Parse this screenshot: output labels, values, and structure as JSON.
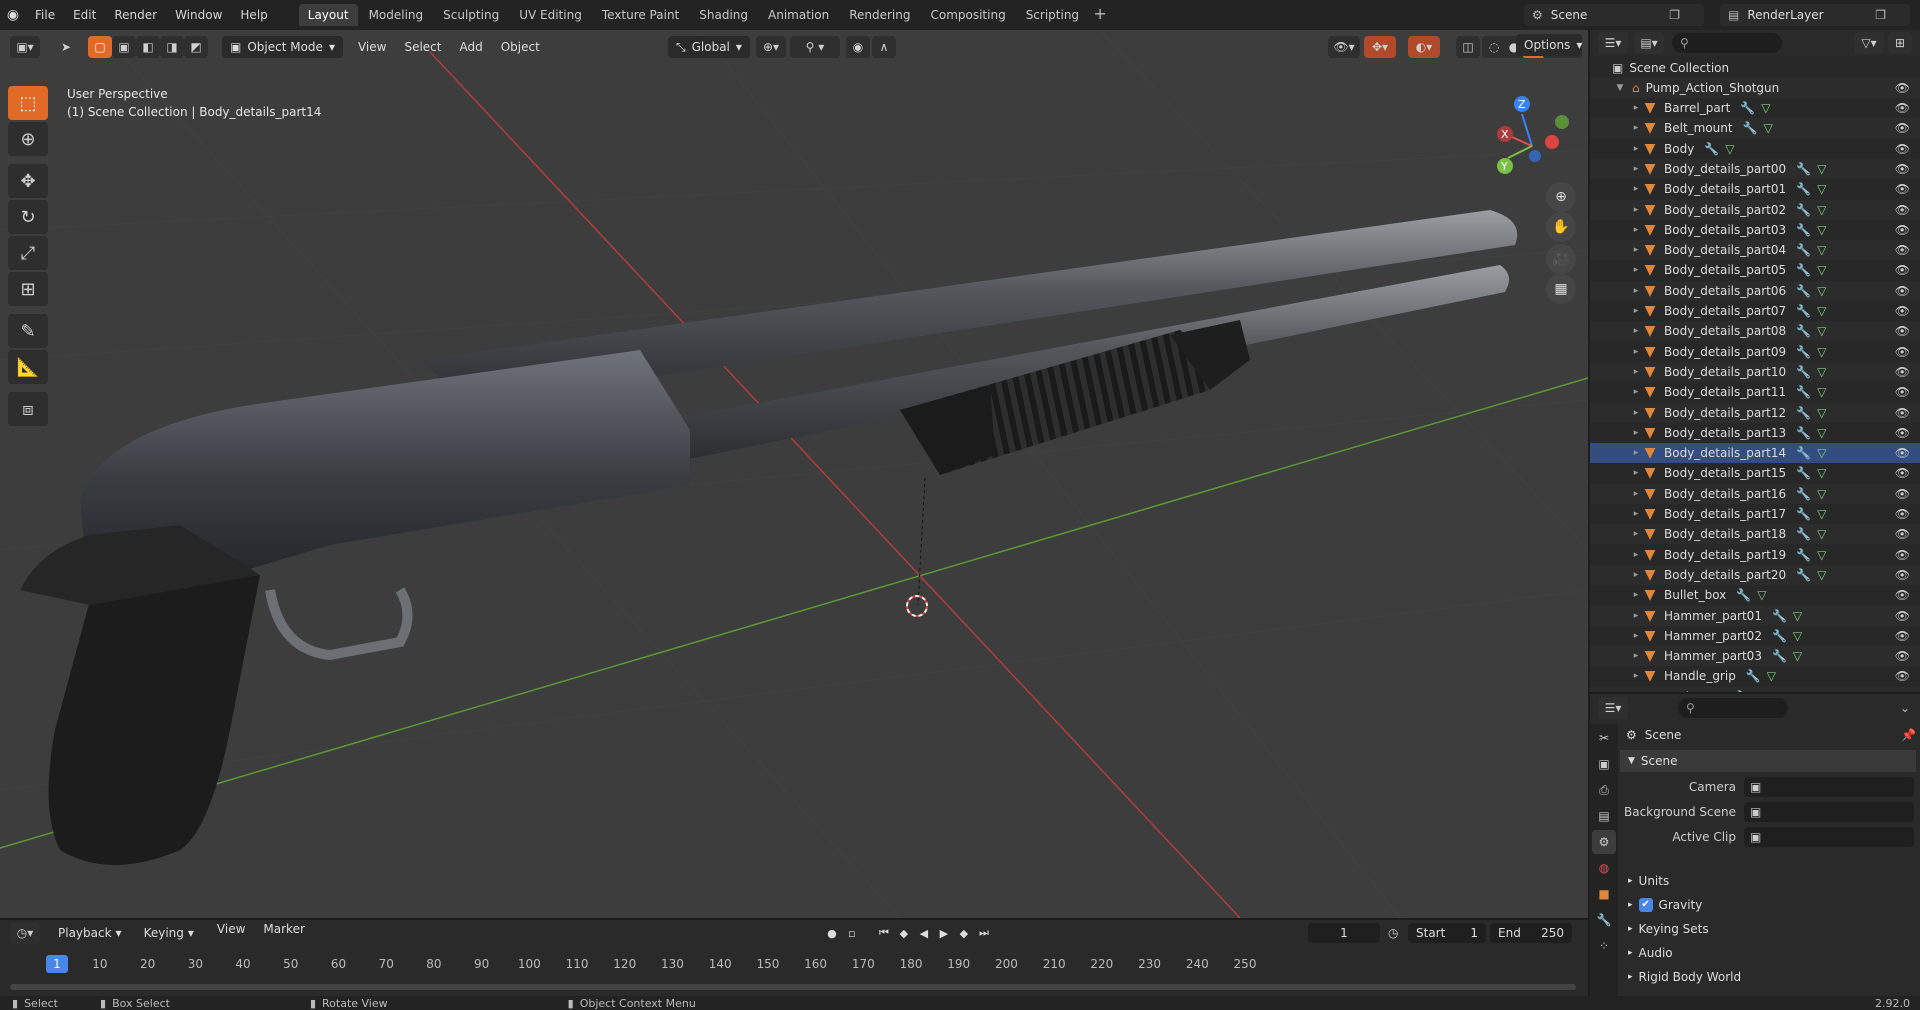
{
  "menu": [
    "File",
    "Edit",
    "Render",
    "Window",
    "Help"
  ],
  "workspaces": [
    "Layout",
    "Modeling",
    "Sculpting",
    "UV Editing",
    "Texture Paint",
    "Shading",
    "Animation",
    "Rendering",
    "Compositing",
    "Scripting"
  ],
  "active_workspace": "Layout",
  "scene_name": "Scene",
  "view_layer": "RenderLayer",
  "viewport": {
    "mode": "Object Mode",
    "menus": [
      "View",
      "Select",
      "Add",
      "Object"
    ],
    "transform_orientation": "Global",
    "options_label": "Options",
    "perspective_label": "User Perspective",
    "collection_label": "(1) Scene Collection | Body_details_part14",
    "gizmo": {
      "x": "X",
      "y": "Y",
      "z": "Z"
    }
  },
  "outliner": {
    "root": "Scene Collection",
    "collection": "Pump_Action_Shotgun",
    "items": [
      "Barrel_part",
      "Belt_mount",
      "Body",
      "Body_details_part00",
      "Body_details_part01",
      "Body_details_part02",
      "Body_details_part03",
      "Body_details_part04",
      "Body_details_part05",
      "Body_details_part06",
      "Body_details_part07",
      "Body_details_part08",
      "Body_details_part09",
      "Body_details_part10",
      "Body_details_part11",
      "Body_details_part12",
      "Body_details_part13",
      "Body_details_part14",
      "Body_details_part15",
      "Body_details_part16",
      "Body_details_part17",
      "Body_details_part18",
      "Body_details_part19",
      "Body_details_part20",
      "Bullet_box",
      "Hammer_part01",
      "Hammer_part02",
      "Hammer_part03",
      "Handle_grip",
      "Recharger"
    ],
    "selected": "Body_details_part14"
  },
  "properties": {
    "context": "Scene",
    "panel": "Scene",
    "fields": [
      {
        "label": "Camera",
        "value": ""
      },
      {
        "label": "Background Scene",
        "value": ""
      },
      {
        "label": "Active Clip",
        "value": ""
      }
    ],
    "sections": [
      "Units",
      "Gravity",
      "Keying Sets",
      "Audio",
      "Rigid Body World"
    ],
    "gravity_checked": true
  },
  "timeline": {
    "menus": [
      "Playback",
      "Keying",
      "View",
      "Marker"
    ],
    "current_frame": "1",
    "start_label": "Start",
    "start": "1",
    "end_label": "End",
    "end": "250",
    "ticks": [
      "1",
      "10",
      "20",
      "30",
      "40",
      "50",
      "60",
      "70",
      "80",
      "90",
      "100",
      "110",
      "120",
      "130",
      "140",
      "150",
      "160",
      "170",
      "180",
      "190",
      "200",
      "210",
      "220",
      "230",
      "240",
      "250"
    ]
  },
  "status": {
    "select": "Select",
    "box_select": "Box Select",
    "rotate_view": "Rotate View",
    "context_menu": "Object Context Menu",
    "version": "2.92.0"
  }
}
